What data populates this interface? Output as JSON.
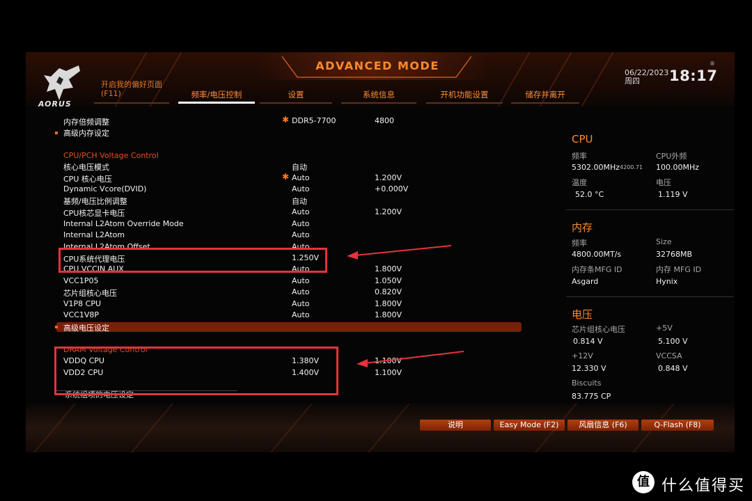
{
  "header": {
    "mode_title": "ADVANCED MODE",
    "logo_text": "AORUS",
    "favorites_line1": "开启我的偏好页面",
    "favorites_line2": "(F11)",
    "tabs": [
      {
        "label": "频率/电压控制",
        "active": true
      },
      {
        "label": "设置",
        "active": false
      },
      {
        "label": "系统信息",
        "active": false
      },
      {
        "label": "开机功能设置",
        "active": false
      },
      {
        "label": "储存并离开",
        "active": false
      }
    ],
    "date": "06/22/2023",
    "weekday": "周四",
    "time": "18:17",
    "reg_icon": "®"
  },
  "settings": {
    "mem_ratio": {
      "label": "内存倍频调整",
      "value": "DDR5-7700",
      "current": "4800"
    },
    "adv_mem": {
      "label": "高级内存设定"
    },
    "cpu_pch_section": "CPU/PCH Voltage Control",
    "rows": [
      {
        "label": "核心电压模式",
        "value": "自动",
        "current": ""
      },
      {
        "label": "CPU 核心电压",
        "value": "Auto",
        "current": "1.200V",
        "star": true
      },
      {
        "label": "Dynamic Vcore(DVID)",
        "value": "Auto",
        "current": "+0.000V"
      },
      {
        "label": "基频/电压比例调整",
        "value": "自动",
        "current": ""
      },
      {
        "label": "CPU核芯显卡电压",
        "value": "Auto",
        "current": "1.200V"
      },
      {
        "label": "Internal L2Atom Override Mode",
        "value": "Auto",
        "current": ""
      },
      {
        "label": "Internal L2Atom",
        "value": "Auto",
        "current": ""
      },
      {
        "label": "Internal L2Atom Offset",
        "value": "Auto",
        "current": ""
      },
      {
        "label": "CPU系统代理电压",
        "value": "1.250V",
        "current": ""
      },
      {
        "label": "CPU VCCIN AUX",
        "value": "Auto",
        "current": "1.800V"
      },
      {
        "label": "VCC1P05",
        "value": "Auto",
        "current": "1.050V"
      },
      {
        "label": "芯片组核心电压",
        "value": "Auto",
        "current": "0.820V"
      },
      {
        "label": "V1P8 CPU",
        "value": "Auto",
        "current": "1.800V"
      },
      {
        "label": "VCC1V8P",
        "value": "Auto",
        "current": "1.800V"
      }
    ],
    "adv_voltage": "高级电压设定",
    "dram_section": "DRAM Voltage Control",
    "dram_rows": [
      {
        "label": "VDDQ CPU",
        "value": "1.380V",
        "current": "1.100V"
      },
      {
        "label": "VDD2 CPU",
        "value": "1.400V",
        "current": "1.100V"
      }
    ],
    "description": "系统组项的电压设定"
  },
  "panel": {
    "cpu_title": "CPU",
    "cpu": {
      "freq_label": "频率",
      "freq_value": "5302.00MHz",
      "freq_sub": "4200.71",
      "bclk_label": "CPU外频",
      "bclk_value": "100.00MHz",
      "temp_label": "温度",
      "temp_value": "52.0 °C",
      "volt_label": "电压",
      "volt_value": "1.119 V"
    },
    "mem_title": "内存",
    "mem": {
      "freq_label": "频率",
      "freq_value": "4800.00MT/s",
      "size_label": "Size",
      "size_value": "32768MB",
      "mfg_label": "内存条MFG ID",
      "mfg_value": "Asgard",
      "chip_label": "内存 MFG ID",
      "chip_value": "Hynix"
    },
    "volt_title": "电压",
    "volt": {
      "chipset_label": "芯片组核心电压",
      "chipset_value": "0.814 V",
      "v5_label": "+5V",
      "v5_value": "5.100 V",
      "v12_label": "+12V",
      "v12_value": "12.330 V",
      "vccsa_label": "VCCSA",
      "vccsa_value": "0.848 V",
      "biscuits_label": "Biscuits",
      "biscuits_value": "83.775 CP"
    }
  },
  "buttons": {
    "help": "说明",
    "easy": "Easy Mode (F2)",
    "fan": "风扇信息 (F6)",
    "qflash": "Q-Flash (F8)"
  },
  "watermark": {
    "icon": "值",
    "text": "什么值得买"
  },
  "colors": {
    "accent": "#ff8a2b",
    "annotation": "#e8323c"
  }
}
